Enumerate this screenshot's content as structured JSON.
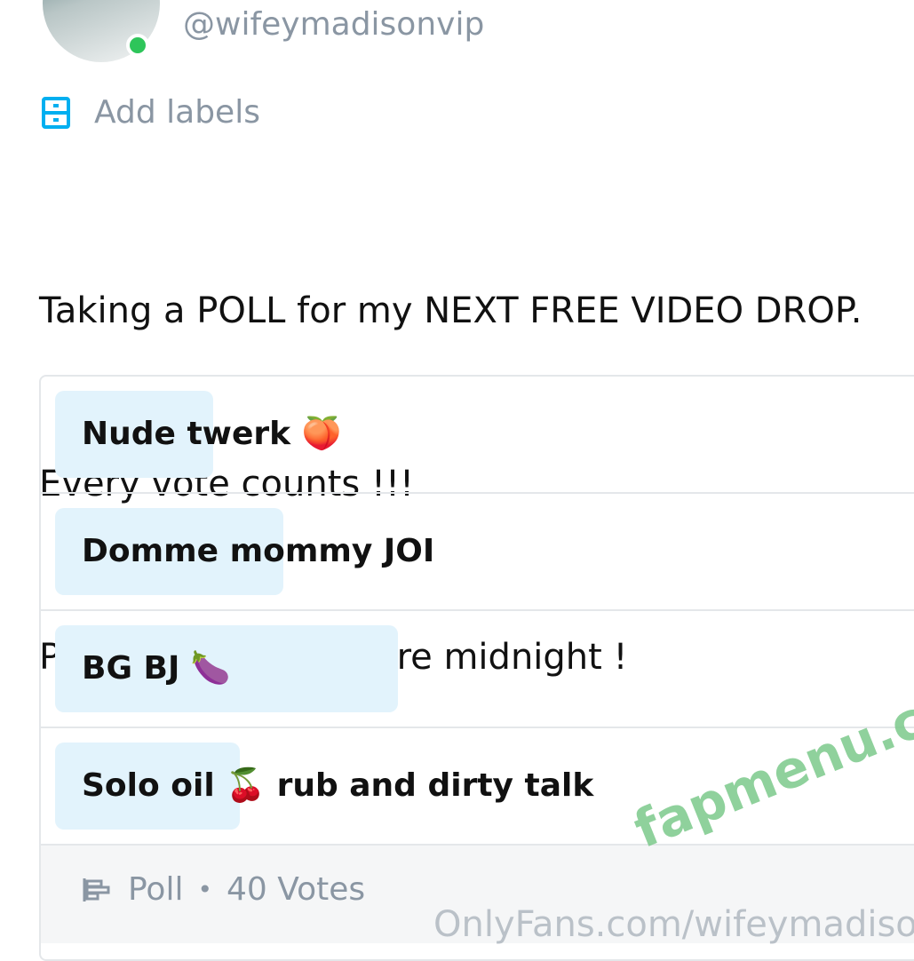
{
  "profile": {
    "handle": "@wifeymadisonvip",
    "online": true
  },
  "labels": {
    "add_label": "Add labels",
    "icon": "labels-icon"
  },
  "post": {
    "lines": [
      "Taking a POLL for my NEXT FREE VIDEO DROP.",
      "Every vote counts !!!",
      "Posting tonight before midnight !"
    ]
  },
  "poll": {
    "options": [
      {
        "label": "Nude twerk 🍑",
        "share": 0.18
      },
      {
        "label": "Domme mommy JOI",
        "share": 0.26
      },
      {
        "label": "BG BJ 🍆",
        "share": 0.39
      },
      {
        "label": "Solo oil 🍒 rub and dirty talk",
        "share": 0.21
      }
    ],
    "footer": {
      "type_label": "Poll",
      "separator": "•",
      "votes_label": "40 Votes",
      "icon": "poll-icon"
    }
  },
  "watermark": {
    "text": "fapmenu.com"
  },
  "footer_url": {
    "text": "OnlyFans.com/wifeymadison"
  },
  "colors": {
    "accent": "#00aff0",
    "online": "#2ec55a",
    "option_fill": "#e2f3fc",
    "muted": "#8a96a3"
  }
}
